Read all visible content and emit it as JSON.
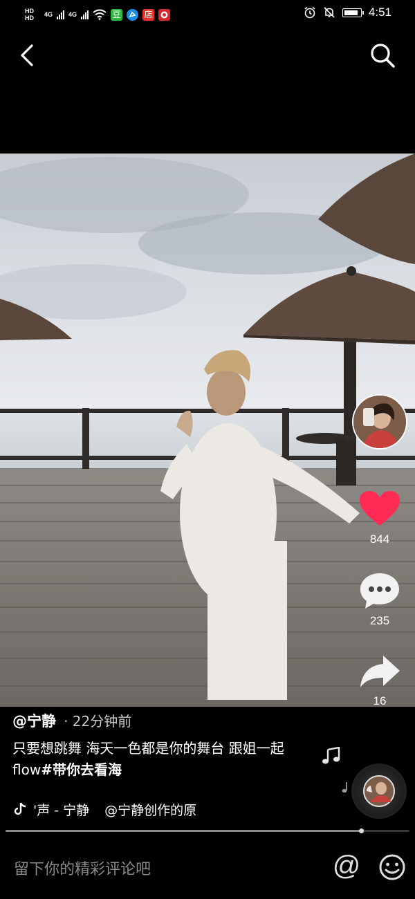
{
  "status_bar": {
    "hd1": "HD",
    "hd2": "HD",
    "net1": "4G",
    "net2": "4G",
    "apps": [
      {
        "label": "豆",
        "color": "#2db83d"
      },
      {
        "label": "",
        "color": "#1a8fe3"
      },
      {
        "label": "店",
        "color": "#e8312a"
      },
      {
        "label": "",
        "color": "#d9232d"
      }
    ],
    "time": "4:51",
    "icons": [
      "hd-icon",
      "signal-icon",
      "wifi-icon",
      "alarm-icon",
      "mute-icon",
      "battery-icon"
    ]
  },
  "nav": {
    "back_icon": "back-chevron-icon",
    "search_icon": "search-icon"
  },
  "actions": {
    "likes": "844",
    "comments": "235",
    "shares": "16",
    "like_color": "#fe2c55"
  },
  "post": {
    "username": "@宁静",
    "timestamp": "· 22分钟前",
    "caption_text": "只要想跳舞 海天一色都是你的舞台 跟姐一起flow",
    "hashtag": "#带你去看海",
    "music_prefix": "'声 - 宁静",
    "music_title": "@宁静创作的原"
  },
  "progress": {
    "fraction": 0.88
  },
  "comment": {
    "placeholder": "留下你的精彩评论吧",
    "at_symbol": "@"
  }
}
